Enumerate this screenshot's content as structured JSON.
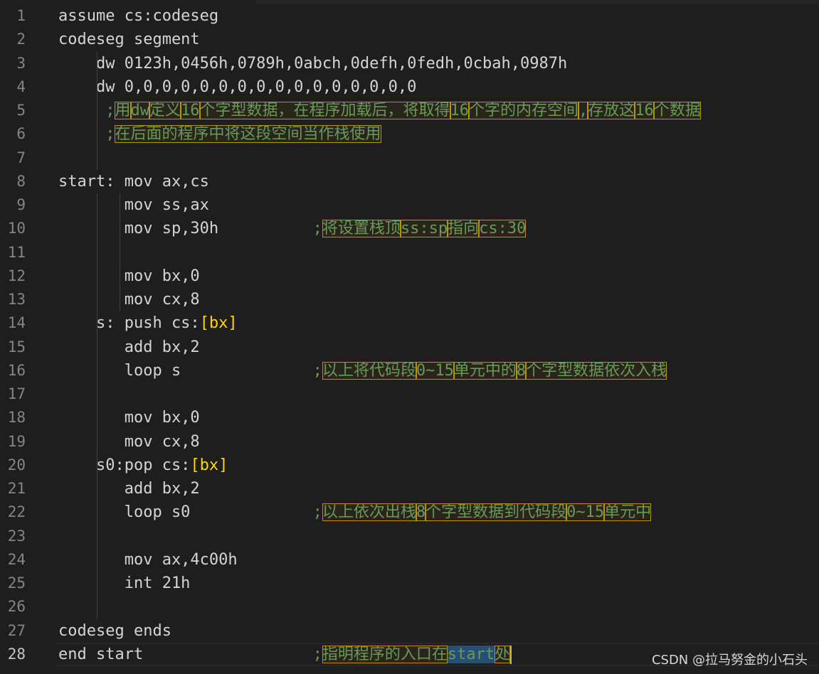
{
  "editor": {
    "lines": [
      {
        "no": "1",
        "code": "assume cs:codeseg"
      },
      {
        "no": "2",
        "code": "codeseg segment"
      },
      {
        "no": "3",
        "code": "    dw 0123h,0456h,0789h,0abch,0defh,0fedh,0cbah,0987h"
      },
      {
        "no": "4",
        "code": "    dw 0,0,0,0,0,0,0,0,0,0,0,0,0,0,0,0"
      },
      {
        "no": "5",
        "code": "     ",
        "comment": [
          ";",
          "用",
          "dw",
          "定义",
          "16",
          "个字型数据，在程序加载后，将取得",
          "16",
          "个字的内存空间",
          ",",
          "存放这",
          "16",
          "个数据"
        ]
      },
      {
        "no": "6",
        "code": "     ",
        "comment": [
          ";",
          "在后面的程序中将这段空间当作栈使用"
        ]
      },
      {
        "no": "7",
        "code": ""
      },
      {
        "no": "8",
        "code": "start: mov ax,cs"
      },
      {
        "no": "9",
        "code": "       mov ss,ax"
      },
      {
        "no": "10",
        "code": "       mov sp,30h          ",
        "comment": [
          ";",
          "将设置栈顶",
          "ss:sp",
          "指向",
          "cs:30"
        ]
      },
      {
        "no": "11",
        "code": ""
      },
      {
        "no": "12",
        "code": "       mov bx,0"
      },
      {
        "no": "13",
        "code": "       mov cx,8"
      },
      {
        "no": "14",
        "code": "    s: push cs:",
        "bracket": "[bx]"
      },
      {
        "no": "15",
        "code": "       add bx,2"
      },
      {
        "no": "16",
        "code": "       loop s              ",
        "comment": [
          ";",
          "以上将代码段",
          "0~15",
          "单元中的",
          "8",
          "个字型数据依次入栈"
        ]
      },
      {
        "no": "17",
        "code": ""
      },
      {
        "no": "18",
        "code": "       mov bx,0"
      },
      {
        "no": "19",
        "code": "       mov cx,8"
      },
      {
        "no": "20",
        "code": "    s0:pop cs:",
        "bracket": "[bx]"
      },
      {
        "no": "21",
        "code": "       add bx,2"
      },
      {
        "no": "22",
        "code": "       loop s0             ",
        "comment": [
          ";",
          "以上依次出栈",
          "8",
          "个字型数据到代码段",
          "0~15",
          "单元中"
        ]
      },
      {
        "no": "23",
        "code": ""
      },
      {
        "no": "24",
        "code": "       mov ax,4c00h"
      },
      {
        "no": "25",
        "code": "       int 21h"
      },
      {
        "no": "26",
        "code": ""
      },
      {
        "no": "27",
        "code": "codeseg ends"
      },
      {
        "no": "28",
        "code": "end start                  ",
        "comment": [
          ";",
          "指明程序的入口在",
          "start",
          "处"
        ],
        "active": true
      }
    ]
  },
  "watermark": "CSDN @拉马努金的小石头",
  "colors": {
    "background": "#1e1e1e",
    "text": "#d4d4d4",
    "comment": "#6a9955",
    "highlight_border": "#b89500",
    "bracket": "#ffd700",
    "line_number": "#858585"
  }
}
